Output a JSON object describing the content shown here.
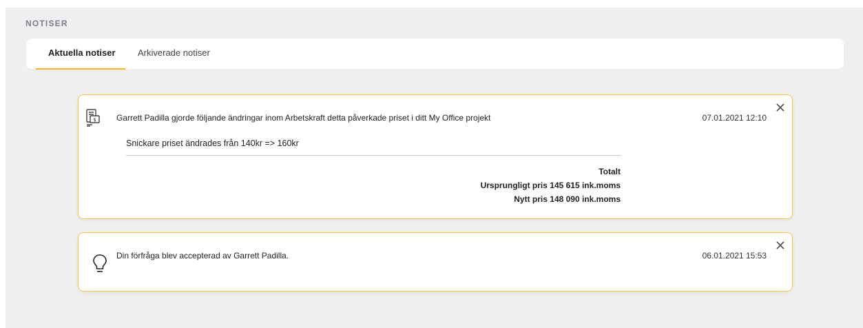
{
  "section_title": "NOTISER",
  "tabs": [
    {
      "label": "Aktuella notiser",
      "active": true
    },
    {
      "label": "Arkiverade notiser",
      "active": false
    }
  ],
  "notifications": [
    {
      "icon": "invoice-money-icon",
      "message": "Garrett Padilla gjorde följande ändringar inom Arbetskraft detta påverkade priset i ditt My Office projekt",
      "date": "07.01.2021 12:10",
      "change": "Snickare priset ändrades från 140kr => 160kr",
      "summary_title": "Totalt",
      "original_price": "Ursprungligt pris 145 615 ink.moms",
      "new_price": "Nytt pris 148 090 ink.moms"
    },
    {
      "icon": "lightbulb-icon",
      "message": "Din förfråga blev accepterad av Garrett Padilla.",
      "date": "06.01.2021 15:53"
    }
  ],
  "colors": {
    "accent": "#f2b722",
    "card_border": "#f5c842",
    "panel_bg": "#efeff1"
  }
}
